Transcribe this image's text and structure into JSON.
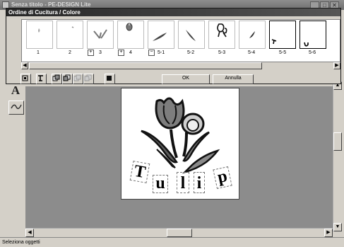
{
  "app": {
    "title": "Senza titolo - PE-DESIGN Lite",
    "window_controls": [
      "_",
      "□",
      "✕"
    ]
  },
  "left_toolbar": {
    "tools": [
      "select-tool",
      "circle-tool",
      "text-tool",
      "embroidery-tool"
    ],
    "text_tool_glyph": "A"
  },
  "dialog": {
    "title": "Ordine di Cucitura / Colore",
    "items": [
      {
        "label": "1",
        "expander": "",
        "icon": "tiny-dot-shape-icon"
      },
      {
        "label": "2",
        "expander": "",
        "icon": "tiny-dash-shape-icon"
      },
      {
        "label": "3",
        "expander": "+",
        "icon": "grass-leaves-icon"
      },
      {
        "label": "4",
        "expander": "+",
        "icon": "tulip-bud-icon"
      },
      {
        "label": "5-1",
        "expander": "−",
        "icon": "leaf-left-icon"
      },
      {
        "label": "5-2",
        "expander": "",
        "icon": "leaf-right-icon"
      },
      {
        "label": "5-3",
        "expander": "",
        "icon": "flower-outline-icon"
      },
      {
        "label": "5-4",
        "expander": "",
        "icon": "small-leaf-icon"
      },
      {
        "label": "5-5",
        "expander": "",
        "icon": "letter-t-mark-icon"
      },
      {
        "label": "5-6",
        "expander": "",
        "icon": "letter-u-mark-icon"
      }
    ],
    "ok_label": "OK",
    "cancel_label": "Annulla",
    "toolbar_icons": [
      "sort-by-color-icon",
      "group-icon",
      "move-front-icon",
      "move-back-icon",
      "move-up-icon",
      "move-down-icon",
      "color-icon"
    ]
  },
  "design": {
    "letters": [
      "T",
      "u",
      "l",
      "i",
      "p"
    ]
  },
  "status_bar": {
    "text": "Seleziona oggetti"
  }
}
